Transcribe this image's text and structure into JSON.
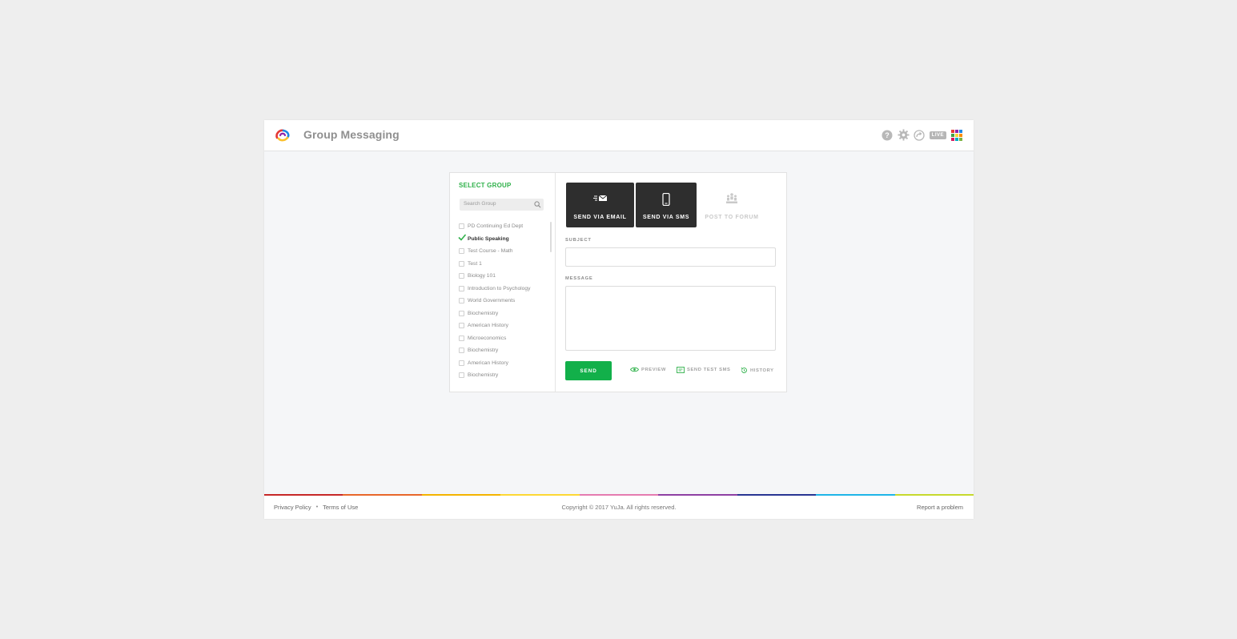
{
  "header": {
    "title": "Group Messaging",
    "icons": [
      "help-icon",
      "gear-icon",
      "share-icon",
      "live-icon",
      "apps-grid-icon"
    ],
    "live_label": "LIVE",
    "grid_colors": [
      "#e53935",
      "#8e24aa",
      "#1e88e5",
      "#43a047",
      "#fdd835",
      "#fb8c00",
      "#d81b60",
      "#00acc1",
      "#7cb342"
    ]
  },
  "groups_panel": {
    "title": "SELECT GROUP",
    "search_placeholder": "Search Group",
    "items": [
      {
        "label": "PD Continuing Ed Dept",
        "checked": false
      },
      {
        "label": "Public Speaking",
        "checked": true
      },
      {
        "label": "Test Course - Math",
        "checked": false
      },
      {
        "label": "Test 1",
        "checked": false
      },
      {
        "label": "Biology 101",
        "checked": false
      },
      {
        "label": "Introduction to Psychology",
        "checked": false
      },
      {
        "label": "World Governments",
        "checked": false
      },
      {
        "label": "Biochemistry",
        "checked": false
      },
      {
        "label": "American History",
        "checked": false
      },
      {
        "label": "Microeconomics",
        "checked": false
      },
      {
        "label": "Biochemistry",
        "checked": false
      },
      {
        "label": "American History",
        "checked": false
      },
      {
        "label": "Biochemistry",
        "checked": false
      }
    ]
  },
  "compose": {
    "tabs": [
      {
        "label": "SEND VIA EMAIL",
        "icon": "email-icon",
        "active": true
      },
      {
        "label": "SEND VIA SMS",
        "icon": "phone-icon",
        "active": true
      },
      {
        "label": "POST TO FORUM",
        "icon": "forum-icon",
        "active": false
      }
    ],
    "subject_label": "SUBJECT",
    "subject_value": "",
    "message_label": "MESSAGE",
    "message_value": "",
    "send_label": "SEND",
    "preview_label": "PREVIEW",
    "test_sms_label": "SEND TEST SMS",
    "history_label": "HISTORY"
  },
  "footer": {
    "privacy": "Privacy Policy",
    "separator": "•",
    "terms": "Terms of Use",
    "copyright": "Copyright © 2017 YuJa. All rights reserved.",
    "report": "Report a problem",
    "rainbow_colors": [
      "#c62828",
      "#e8672a",
      "#f4b400",
      "#fdd835",
      "#e57bb0",
      "#8e3fa3",
      "#283593",
      "#1fb5e8",
      "#c6d92d"
    ]
  },
  "colors": {
    "accent_green": "#2fb14a",
    "send_green": "#12b04a",
    "dark_tab": "#2e2e2e"
  }
}
